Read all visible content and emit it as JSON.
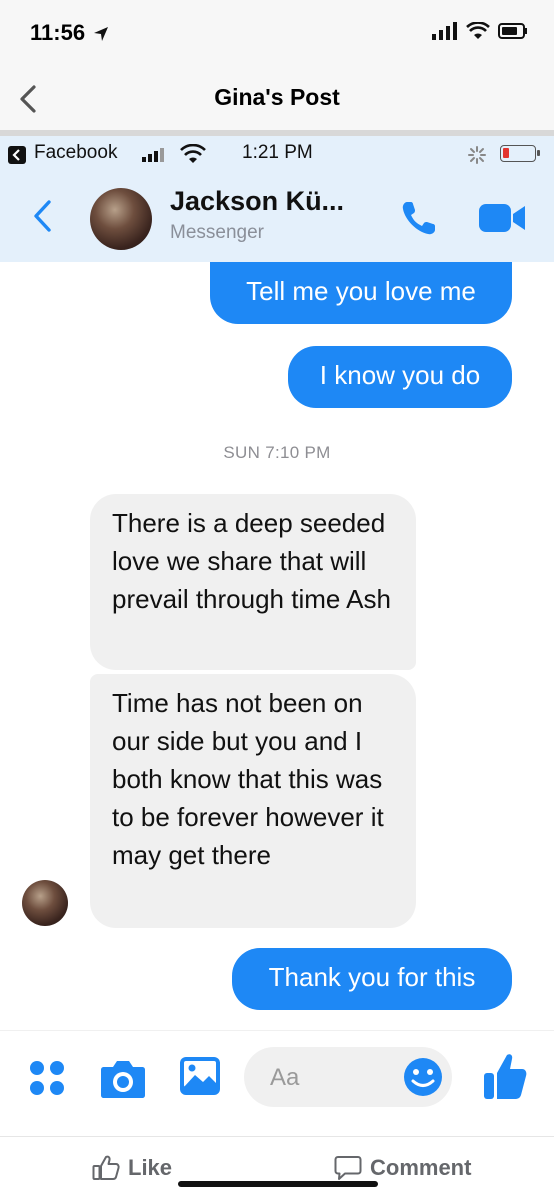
{
  "os_status": {
    "time": "11:56"
  },
  "outer_nav": {
    "title": "Gina's Post"
  },
  "inner_status": {
    "app": "Facebook",
    "time": "1:21 PM"
  },
  "chat_header": {
    "name": "Jackson Kü...",
    "subtitle": "Messenger",
    "accent": "#1e88f5"
  },
  "messages": [
    {
      "sender": "me",
      "text": "Tell me you love me"
    },
    {
      "sender": "me",
      "text": "I know you do"
    },
    {
      "sender": "them",
      "text": "There is a deep seeded love we share that will prevail through time Ash"
    },
    {
      "sender": "them",
      "text": "Time has not been on our side but you and I both know that this was to be forever however it may get there"
    },
    {
      "sender": "me",
      "text": "Thank you for this"
    }
  ],
  "timestamp": "SUN 7:10 PM",
  "composer": {
    "placeholder": "Aa"
  },
  "post_actions": {
    "like": "Like",
    "comment": "Comment"
  }
}
